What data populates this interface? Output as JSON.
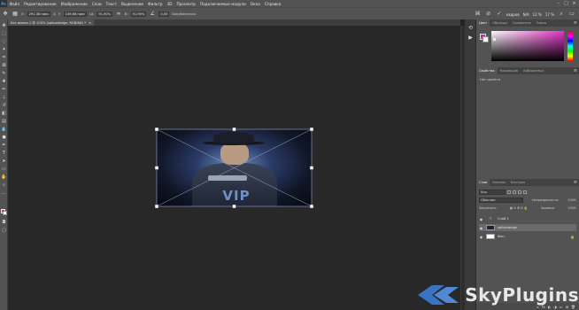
{
  "menubar": {
    "logo": "Ps",
    "items": [
      "Файл",
      "Редактирование",
      "Изображение",
      "Слои",
      "Текст",
      "Выделение",
      "Фильтр",
      "3D",
      "Просмотр",
      "Подключаемые модули",
      "Окно",
      "Справка"
    ],
    "window_controls": [
      "–",
      "□",
      "×"
    ]
  },
  "options": {
    "x_value": "291,38 пикс",
    "y_value": "149,86 пикс",
    "w_value": "91,90%",
    "h_value": "91,90%",
    "angle_value": "0,00",
    "interp_value": "Бикубическая",
    "workspace_label": "кадров",
    "workspace_value": "N/A",
    "zoom_label": "12 %",
    "zoom_value": "17 %"
  },
  "document": {
    "tab_title": "Без имени-1 @ 100% (splicodesign, RGB/8#) *",
    "image_text": "VIP"
  },
  "color_panel": {
    "tabs": [
      "Цвет",
      "Образцы",
      "Градиенты",
      "Узоры"
    ],
    "fg_color": "#c02f9a",
    "bg_color": "#ffffff"
  },
  "properties_panel": {
    "tabs": [
      "Свойства",
      "Коррекция",
      "Библиотеки"
    ],
    "body": "Нет свойств"
  },
  "layers_panel": {
    "tabs": [
      "Слои",
      "Каналы",
      "Контуры"
    ],
    "filter_label": "Вид",
    "blend_mode": "Обычные",
    "opacity_label": "Непрозрачность:",
    "opacity_value": "100%",
    "lock_label": "Закрепить:",
    "fill_label": "Заливка:",
    "fill_value": "100%",
    "layers": [
      {
        "name": "Слой 1",
        "type": "text"
      },
      {
        "name": "splicodesign",
        "type": "image",
        "selected": true
      },
      {
        "name": "Фон",
        "type": "background"
      }
    ]
  },
  "watermark": {
    "text": "SkyPlugins"
  }
}
